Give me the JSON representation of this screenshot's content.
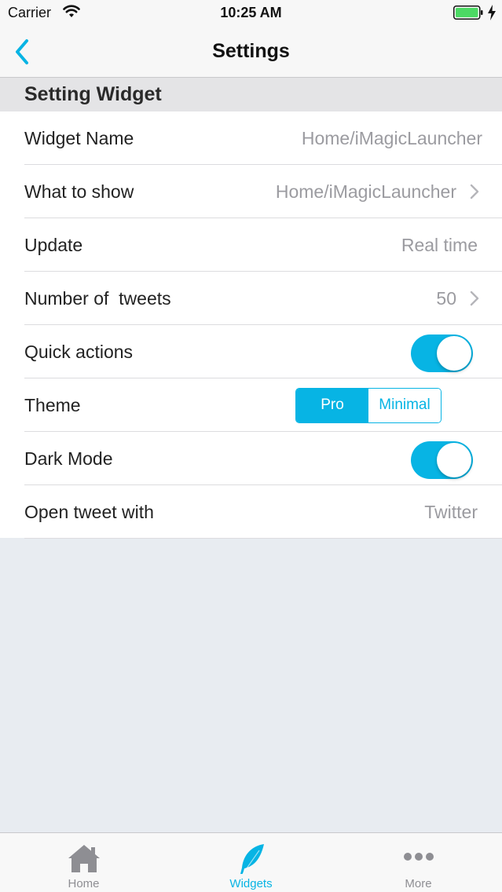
{
  "status_bar": {
    "carrier": "Carrier",
    "time": "10:25 AM",
    "battery_color": "#4cd964"
  },
  "nav": {
    "title": "Settings",
    "back_icon": "chevron-left-icon",
    "accent": "#07b4e4"
  },
  "section": {
    "title": "Setting Widget"
  },
  "rows": {
    "widget_name": {
      "label": "Widget Name",
      "value": "Home/iMagicLauncher"
    },
    "what_to_show": {
      "label": "What to show",
      "value": "Home/iMagicLauncher"
    },
    "update": {
      "label": "Update",
      "value": "Real time"
    },
    "number_of_tweets": {
      "label": "Number of  tweets",
      "value": "50"
    },
    "quick_actions": {
      "label": "Quick actions",
      "toggle_on": true
    },
    "theme": {
      "label": "Theme",
      "options": [
        "Pro",
        "Minimal"
      ],
      "selected": "Pro"
    },
    "dark_mode": {
      "label": "Dark Mode",
      "toggle_on": true
    },
    "open_tweet_with": {
      "label": "Open tweet with",
      "value": "Twitter"
    }
  },
  "tab_bar": {
    "tabs": [
      {
        "label": "Home",
        "icon": "house-icon",
        "color": "#8e8e93"
      },
      {
        "label": "Widgets",
        "icon": "feather-icon",
        "color": "#07b4e4"
      },
      {
        "label": "More",
        "icon": "more-dots-icon",
        "color": "#8e8e93"
      }
    ]
  }
}
